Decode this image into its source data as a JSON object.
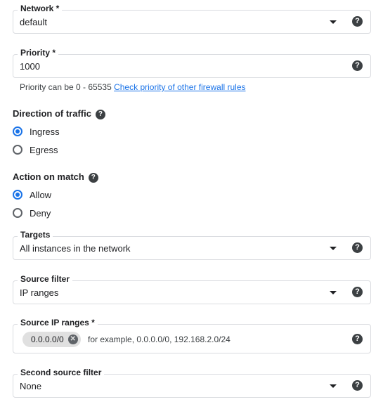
{
  "network": {
    "label": "Network *",
    "value": "default"
  },
  "priority": {
    "label": "Priority *",
    "value": "1000",
    "hint": "Priority can be 0 - 65535",
    "link": "Check priority of other firewall rules"
  },
  "direction": {
    "title": "Direction of traffic",
    "options": [
      "Ingress",
      "Egress"
    ],
    "selected": "Ingress"
  },
  "action": {
    "title": "Action on match",
    "options": [
      "Allow",
      "Deny"
    ],
    "selected": "Allow"
  },
  "targets": {
    "label": "Targets",
    "value": "All instances in the network"
  },
  "source_filter": {
    "label": "Source filter",
    "value": "IP ranges"
  },
  "source_ip_ranges": {
    "label": "Source IP ranges *",
    "chip": "0.0.0.0/0",
    "placeholder": "for example, 0.0.0.0/0, 192.168.2.0/24"
  },
  "second_source_filter": {
    "label": "Second source filter",
    "value": "None"
  },
  "icons": {
    "help": "help-icon",
    "dropdown": "arrow-drop-down-icon",
    "chip_remove": "cancel-icon"
  },
  "colors": {
    "accent": "#1a73e8",
    "border": "#dadce0",
    "text": "#202124"
  }
}
